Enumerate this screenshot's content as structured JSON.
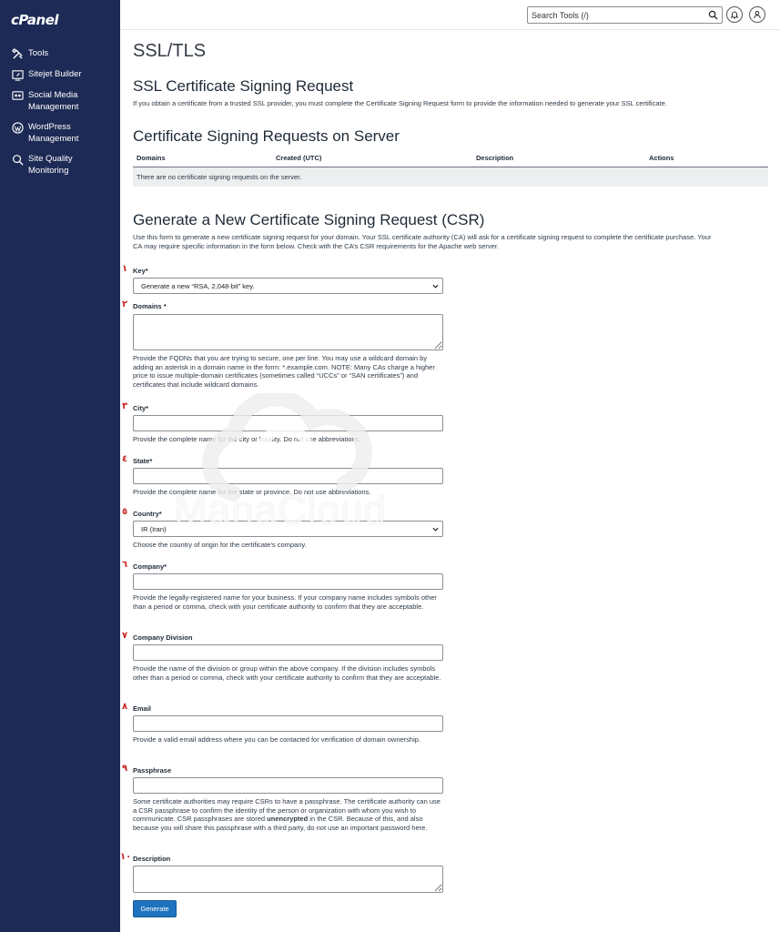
{
  "brand": {
    "logo": "cPanel"
  },
  "sidebar": {
    "items": [
      {
        "label": "Tools",
        "icon": "tools-icon"
      },
      {
        "label": "Sitejet Builder",
        "icon": "sitejet-icon"
      },
      {
        "label": "Social Media Management",
        "icon": "social-media-icon"
      },
      {
        "label": "WordPress Management",
        "icon": "wordpress-icon"
      },
      {
        "label": "Site Quality Monitoring",
        "icon": "site-quality-icon"
      }
    ]
  },
  "topbar": {
    "search_placeholder": "Search Tools (/)",
    "icons": [
      "search-icon",
      "bell-icon",
      "user-icon"
    ]
  },
  "page": {
    "title": "SSL/TLS",
    "csr_heading": "SSL Certificate Signing Request",
    "csr_intro": "If you obtain a certificate from a trusted SSL provider, you must complete the Certificate Signing Request form to provide the information needed to generate your SSL certificate.",
    "server_heading": "Certificate Signing Requests on Server",
    "table": {
      "columns": [
        "Domains",
        "Created (UTC)",
        "Description",
        "Actions"
      ],
      "empty_message": "There are no certificate signing requests on the server."
    },
    "generate_heading": "Generate a New Certificate Signing Request (CSR)",
    "generate_intro_1": "Use this form to generate a new certificate signing request for your domain. Your SSL certificate authority (CA) will ask for a certificate signing request to complete the certificate purchase. Your",
    "generate_intro_2": "CA may require specific information in the form below. Check with the CA’s CSR requirements for the Apache web server."
  },
  "form": {
    "key": {
      "num": "١",
      "label": "Key*",
      "value": "Generate a new “RSA, 2,048-bit” key."
    },
    "domains": {
      "num": "٢",
      "label": "Domains *",
      "help": "Provide the FQDNs that you are trying to secure, one per line. You may use a wildcard domain by adding an asterisk in a domain name in the form: *.example.com. NOTE: Many CAs charge a higher price to issue multiple-domain certificates (sometimes called “UCCs” or “SAN certificates”) and certificates that include wildcard domains."
    },
    "city": {
      "num": "٣",
      "label": "City*",
      "help": "Provide the complete name for the city or locality. Do not use abbreviations."
    },
    "state": {
      "num": "٤",
      "label": "State*",
      "help": "Provide the complete name for the state or province. Do not use abbreviations."
    },
    "country": {
      "num": "٥",
      "label": "Country*",
      "value": "IR (Iran)",
      "help": "Choose the country of origin for the certificate’s company."
    },
    "company": {
      "num": "٦",
      "label": "Company*",
      "help": "Provide the legally-registered name for your business. If your company name includes symbols other than a period or comma, check with your certificate authority to confirm that they are acceptable."
    },
    "division": {
      "num": "٧",
      "label": "Company Division",
      "help": "Provide the name of the division or group within the above company. If the division includes symbols other than a period or comma, check with your certificate authority to confirm that they are acceptable."
    },
    "email": {
      "num": "٨",
      "label": "Email",
      "help": "Provide a valid email address where you can be contacted for verification of domain ownership."
    },
    "passphrase": {
      "num": "٩",
      "label": "Passphrase",
      "help_1": "Some certificate authorities may require CSRs to have a passphrase. The certificate authority can use a CSR passphrase to confirm the identity of the person or organization with whom you wish to communicate. CSR passphrases are stored",
      "help_bold": "unencrypted",
      "help_2": "in the CSR. Because of this, and also because you will share this passphrase with a third party, do not use an important password here."
    },
    "description": {
      "num": "١٠",
      "label": "Description"
    },
    "submit_label": "Generate"
  },
  "watermark": {
    "text": "ManaCloud"
  }
}
